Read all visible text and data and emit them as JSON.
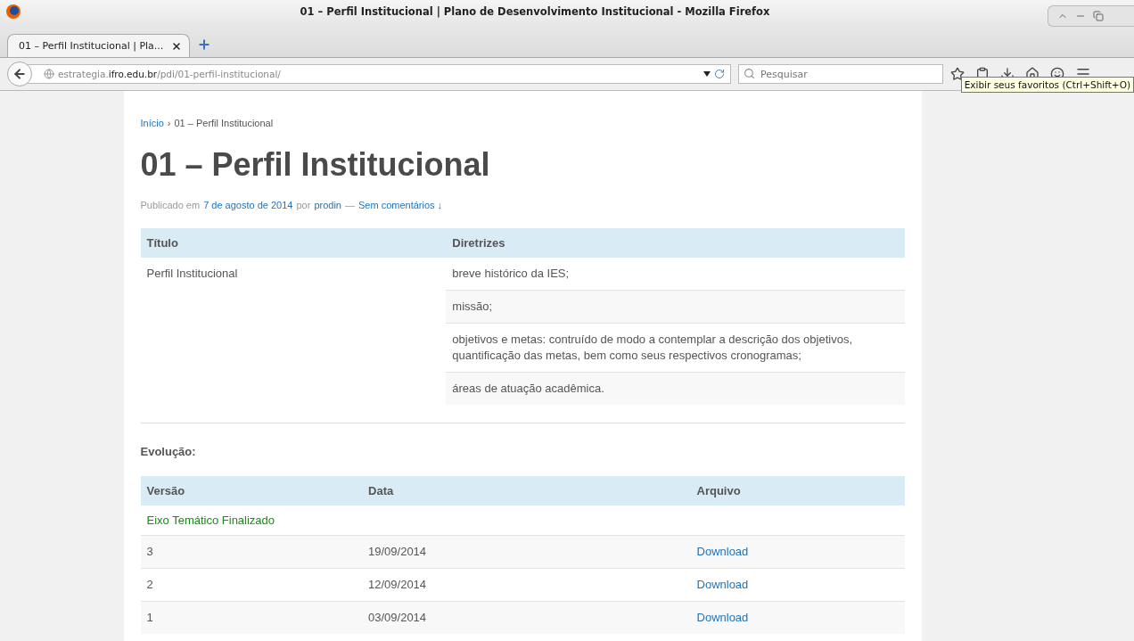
{
  "window": {
    "title": "01 – Perfil Institucional | Plano de Desenvolvimento Institucional - Mozilla Firefox"
  },
  "tabs": [
    {
      "label": "01 – Perfil Institucional | Pla...",
      "selected": true
    }
  ],
  "address_bar": {
    "domain_prefix": "estrategia.",
    "domain": "ifro.edu.br",
    "path": "/pdi/01-perfil-institucional/"
  },
  "search": {
    "placeholder": "Pesquisar"
  },
  "tooltip": "Exibir seus favoritos (Ctrl+Shift+O)",
  "breadcrumb": {
    "home": "Início",
    "separator": "›",
    "current": "01 – Perfil Institucional"
  },
  "heading": "01 – Perfil Institucional",
  "meta": {
    "prefix": "Publicado em",
    "date": "7 de agosto de 2014",
    "by": "por",
    "author": "prodin",
    "dash": "—",
    "comments": "Sem comentários ↓"
  },
  "table": {
    "columns": [
      "Título",
      "Diretrizes"
    ],
    "title_cell": "Perfil Institucional",
    "guidelines": [
      "breve histórico da IES;",
      "missão;",
      "objetivos e metas: contruído de modo a contemplar a descrição dos objetivos, quantificação das metas, bem como seus respectivos cronogramas;",
      "áreas de atuação acadêmica."
    ]
  },
  "evolution": {
    "label": "Evolução:",
    "columns": [
      "Versão",
      "Data",
      "Arquivo"
    ],
    "group": "Eixo Temático Finalizado",
    "rows": [
      {
        "version": "3",
        "date": "19/09/2014",
        "file": "Download"
      },
      {
        "version": "2",
        "date": "12/09/2014",
        "file": "Download"
      },
      {
        "version": "1",
        "date": "03/09/2014",
        "file": "Download"
      }
    ]
  }
}
